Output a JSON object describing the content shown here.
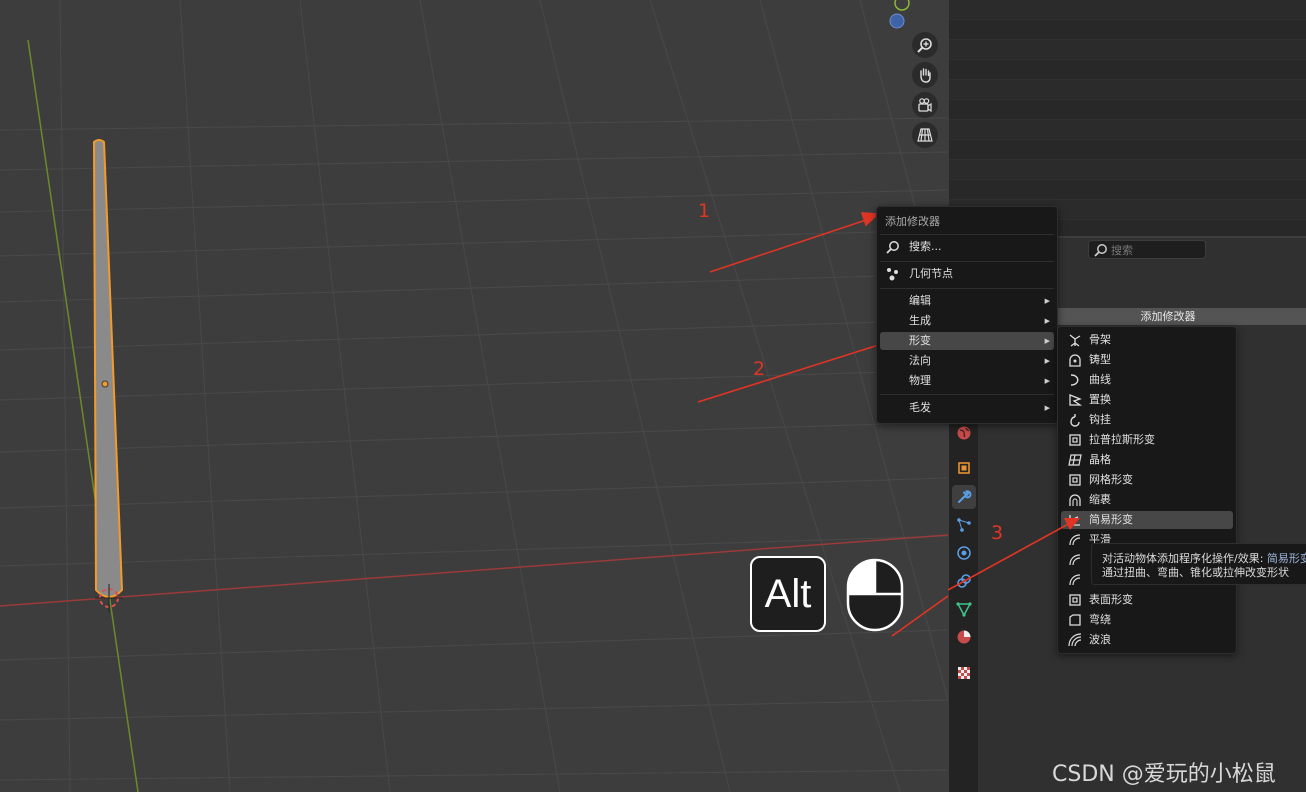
{
  "viewport": {
    "nav_buttons": [
      "zoom-icon",
      "pan-hand-icon",
      "camera-icon",
      "perspective-grid-icon"
    ]
  },
  "properties": {
    "search_placeholder": "搜索",
    "add_modifier_label": "添加修改器"
  },
  "add_modifier_menu": {
    "title": "添加修改器",
    "search": "搜索...",
    "geometry_nodes": "几何节点",
    "items": [
      {
        "label": "编辑",
        "has_submenu": true
      },
      {
        "label": "生成",
        "has_submenu": true
      },
      {
        "label": "形变",
        "has_submenu": true,
        "highlighted": true
      },
      {
        "label": "法向",
        "has_submenu": true
      },
      {
        "label": "物理",
        "has_submenu": true
      }
    ],
    "hair": "毛发"
  },
  "deform_submenu": {
    "items": [
      {
        "label": "骨架",
        "icon": "armature-icon"
      },
      {
        "label": "铸型",
        "icon": "cast-icon"
      },
      {
        "label": "曲线",
        "icon": "curve-icon"
      },
      {
        "label": "置换",
        "icon": "displace-icon"
      },
      {
        "label": "钩挂",
        "icon": "hook-icon"
      },
      {
        "label": "拉普拉斯形变",
        "icon": "laplacian-icon"
      },
      {
        "label": "晶格",
        "icon": "lattice-icon"
      },
      {
        "label": "网格形变",
        "icon": "mesh-deform-icon"
      },
      {
        "label": "缩裹",
        "icon": "shrinkwrap-icon"
      },
      {
        "label": "简易形变",
        "icon": "simple-deform-icon",
        "highlighted": true
      },
      {
        "label": "平滑",
        "icon": "smooth-icon"
      },
      {
        "label": "",
        "icon": "smooth-corrective-icon"
      },
      {
        "label": "",
        "icon": "smooth-laplacian-icon"
      },
      {
        "label": "表面形变",
        "icon": "surface-deform-icon"
      },
      {
        "label": "弯绕",
        "icon": "warp-icon"
      },
      {
        "label": "波浪",
        "icon": "wave-icon"
      }
    ]
  },
  "tooltip": {
    "line1_prefix": "对活动物体添加程序化操作/效果:",
    "line1_highlight": "简易形变",
    "line2": "通过扭曲、弯曲、锥化或拉伸改变形状"
  },
  "annotations": {
    "step1": "1",
    "step2": "2",
    "step3": "3",
    "key": "Alt",
    "color": "#e03524"
  },
  "watermark": "CSDN @爱玩的小松鼠"
}
